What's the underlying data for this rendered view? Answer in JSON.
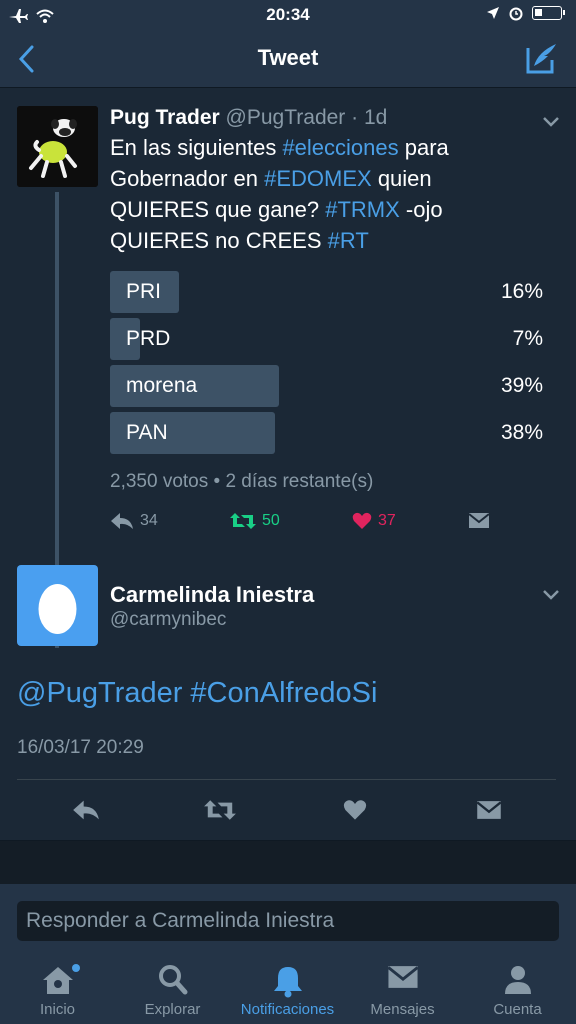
{
  "status_bar": {
    "time": "20:34"
  },
  "nav": {
    "title": "Tweet"
  },
  "tweet": {
    "author_name": "Pug Trader",
    "author_handle": "@PugTrader",
    "age": "· 1d",
    "text_parts": [
      {
        "t": "En las siguientes ",
        "h": false
      },
      {
        "t": "#elecciones",
        "h": true
      },
      {
        "t": " para Gobernador en ",
        "h": false
      },
      {
        "t": "#EDOMEX",
        "h": true
      },
      {
        "t": " quien QUIERES que gane? ",
        "h": false
      },
      {
        "t": "#TRMX",
        "h": true
      },
      {
        "t": " -ojo QUIERES no CREES ",
        "h": false
      },
      {
        "t": "#RT",
        "h": true
      }
    ],
    "poll": {
      "options": [
        {
          "label": "PRI",
          "pct_text": "16%",
          "value": 16
        },
        {
          "label": "PRD",
          "pct_text": "7%",
          "value": 7
        },
        {
          "label": "morena",
          "pct_text": "39%",
          "value": 39
        },
        {
          "label": "PAN",
          "pct_text": "38%",
          "value": 38
        }
      ],
      "meta": "2,350 votos • 2 días restante(s)"
    },
    "counts": {
      "replies": "34",
      "retweets": "50",
      "likes": "37"
    },
    "colors": {
      "retweet": "#19cf86",
      "like": "#e0245e",
      "link": "#4a9fe6"
    }
  },
  "reply": {
    "author_name": "Carmelinda Iniestra",
    "author_handle": "@carmynibec",
    "text": "@PugTrader #ConAlfredoSi",
    "timestamp": "16/03/17 20:29"
  },
  "composer": {
    "placeholder": "Responder a Carmelinda Iniestra"
  },
  "tabs": [
    {
      "label": "Inicio",
      "icon": "home-icon"
    },
    {
      "label": "Explorar",
      "icon": "search-icon"
    },
    {
      "label": "Notificaciones",
      "icon": "bell-icon",
      "active": true
    },
    {
      "label": "Mensajes",
      "icon": "mail-icon"
    },
    {
      "label": "Cuenta",
      "icon": "person-icon"
    }
  ]
}
